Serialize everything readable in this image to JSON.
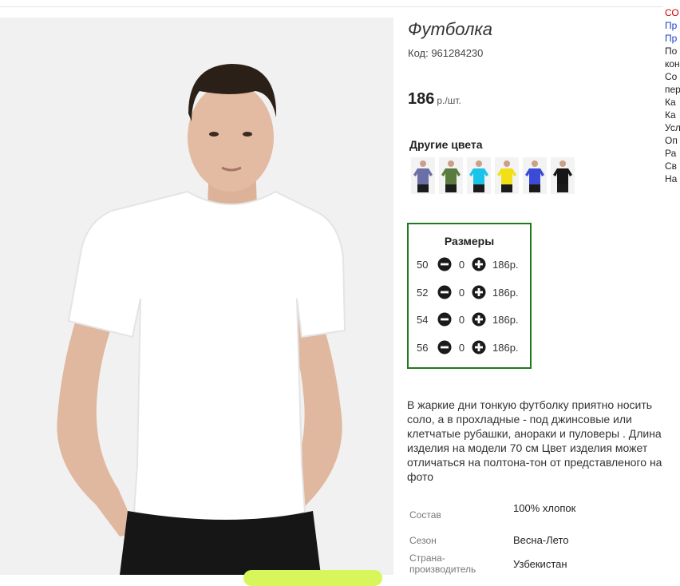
{
  "product": {
    "title": "Футболка",
    "code": "Код: 961284230",
    "price_value": "186",
    "price_unit": "р./шт."
  },
  "colors": {
    "title": "Другие цвета",
    "swatches": [
      {
        "name": "grey-blue",
        "color": "#6a6fa6"
      },
      {
        "name": "olive",
        "color": "#5b7a3d"
      },
      {
        "name": "cyan",
        "color": "#19c3e9"
      },
      {
        "name": "yellow",
        "color": "#f2e017"
      },
      {
        "name": "blue",
        "color": "#3b4bd8"
      },
      {
        "name": "black",
        "color": "#161616"
      }
    ]
  },
  "sizes": {
    "title": "Размеры",
    "rows": [
      {
        "size": "50",
        "qty": "0",
        "price": "186р."
      },
      {
        "size": "52",
        "qty": "0",
        "price": "186р."
      },
      {
        "size": "54",
        "qty": "0",
        "price": "186р."
      },
      {
        "size": "56",
        "qty": "0",
        "price": "186р."
      }
    ],
    "icons": {
      "minus": "minus-circle-icon",
      "plus": "plus-circle-icon"
    },
    "border_color": "#1d7a1d"
  },
  "description": "В жаркие дни тонкую футболку приятно носить соло, а в прохладные - под джинсовые или клетчатые рубашки, анораки и пуловеры . Длина изделия на модели 70 см Цвет изделия может отличаться на полтона-тон от представленого на фото",
  "specs": [
    {
      "label": "Состав",
      "value": "100% хлопок"
    },
    {
      "label": "Сезон",
      "value": "Весна-Лето"
    },
    {
      "label": "Страна-производитель",
      "value": "Узбекистан"
    }
  ],
  "side_menu": [
    "СО",
    "Пр",
    "Пр",
    "По",
    "кон",
    "Со",
    "пер",
    "Ка",
    "Ка",
    "Усл",
    "Оп",
    "Ра",
    "Св",
    "На"
  ],
  "accent_colors": {
    "menu_red": "#d00000",
    "menu_blue": "#1d3fc0",
    "banner": "#d8f55b"
  }
}
